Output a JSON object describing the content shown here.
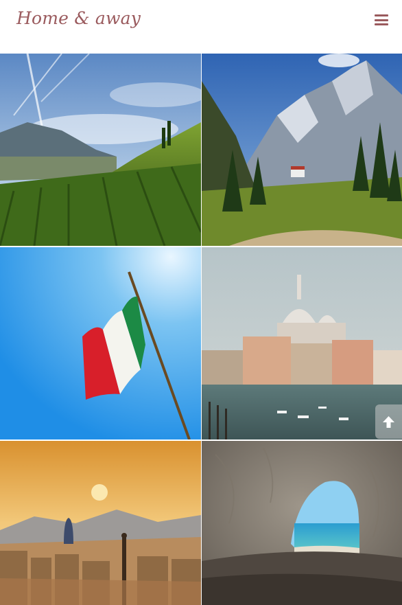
{
  "header": {
    "brand": "Home & away",
    "menu_icon": "hamburger-menu-icon",
    "accent_color": "#9a5a5d"
  },
  "gallery": {
    "tiles": [
      {
        "name": "vineyard-photo"
      },
      {
        "name": "dolomites-photo"
      },
      {
        "name": "italian-flag-photo"
      },
      {
        "name": "venice-canal-photo"
      },
      {
        "name": "city-sunset-photo"
      },
      {
        "name": "sea-cave-photo"
      }
    ]
  },
  "back_to_top": {
    "icon": "arrow-up-icon"
  }
}
